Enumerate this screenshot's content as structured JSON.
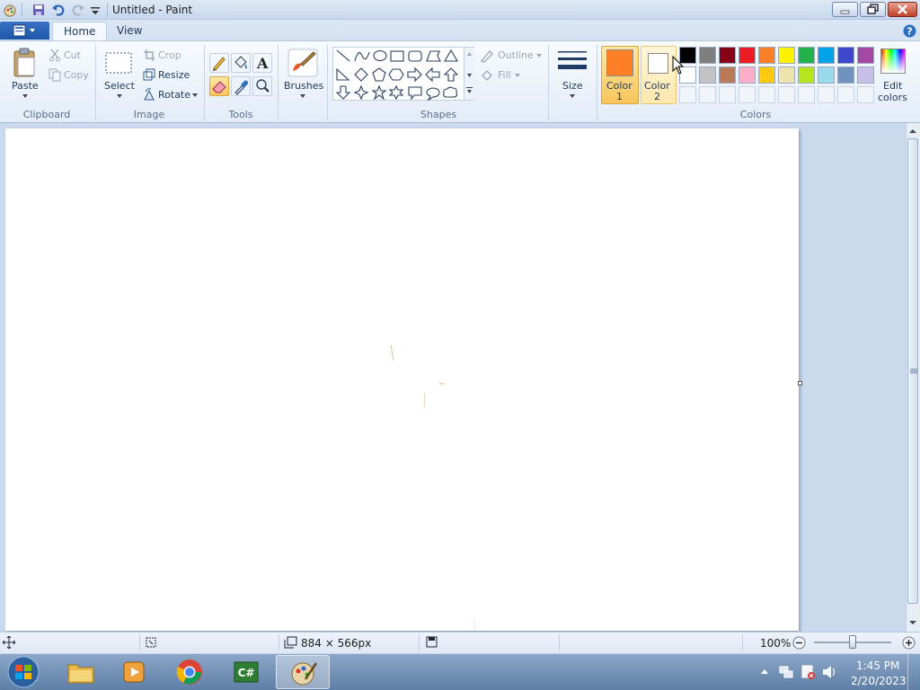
{
  "window": {
    "title": "Untitled - Paint"
  },
  "tabs": {
    "home": "Home",
    "view": "View"
  },
  "clipboard": {
    "paste": "Paste",
    "cut": "Cut",
    "copy": "Copy",
    "group": "Clipboard"
  },
  "image": {
    "select": "Select",
    "crop": "Crop",
    "resize": "Resize",
    "rotate": "Rotate",
    "group": "Image"
  },
  "tools": {
    "group": "Tools",
    "text_glyph": "A"
  },
  "brushes": {
    "label": "Brushes"
  },
  "shapes": {
    "outline": "Outline",
    "fill": "Fill",
    "group": "Shapes"
  },
  "size": {
    "label": "Size"
  },
  "colors": {
    "color1_line1": "Color",
    "color1_line2": "1",
    "color2_line1": "Color",
    "color2_line2": "2",
    "edit_line1": "Edit",
    "edit_line2": "colors",
    "group": "Colors",
    "color1_value": "#ff7f27",
    "color2_value": "#ffffff",
    "row1": [
      "#000000",
      "#7f7f7f",
      "#880015",
      "#ed1c24",
      "#ff7f27",
      "#fff200",
      "#22b14c",
      "#00a2e8",
      "#3f48cc",
      "#a349a4"
    ],
    "row2": [
      "#ffffff",
      "#c3c3c3",
      "#b97a57",
      "#ffaec9",
      "#ffc90e",
      "#efe4b0",
      "#b5e61d",
      "#99d9ea",
      "#7092be",
      "#c8bfe7"
    ]
  },
  "status": {
    "canvas_size": "884 × 566px",
    "zoom": "100%",
    "zoom_level": 100
  },
  "taskbar": {
    "time": "1:45 PM",
    "date": "2/20/2023"
  }
}
